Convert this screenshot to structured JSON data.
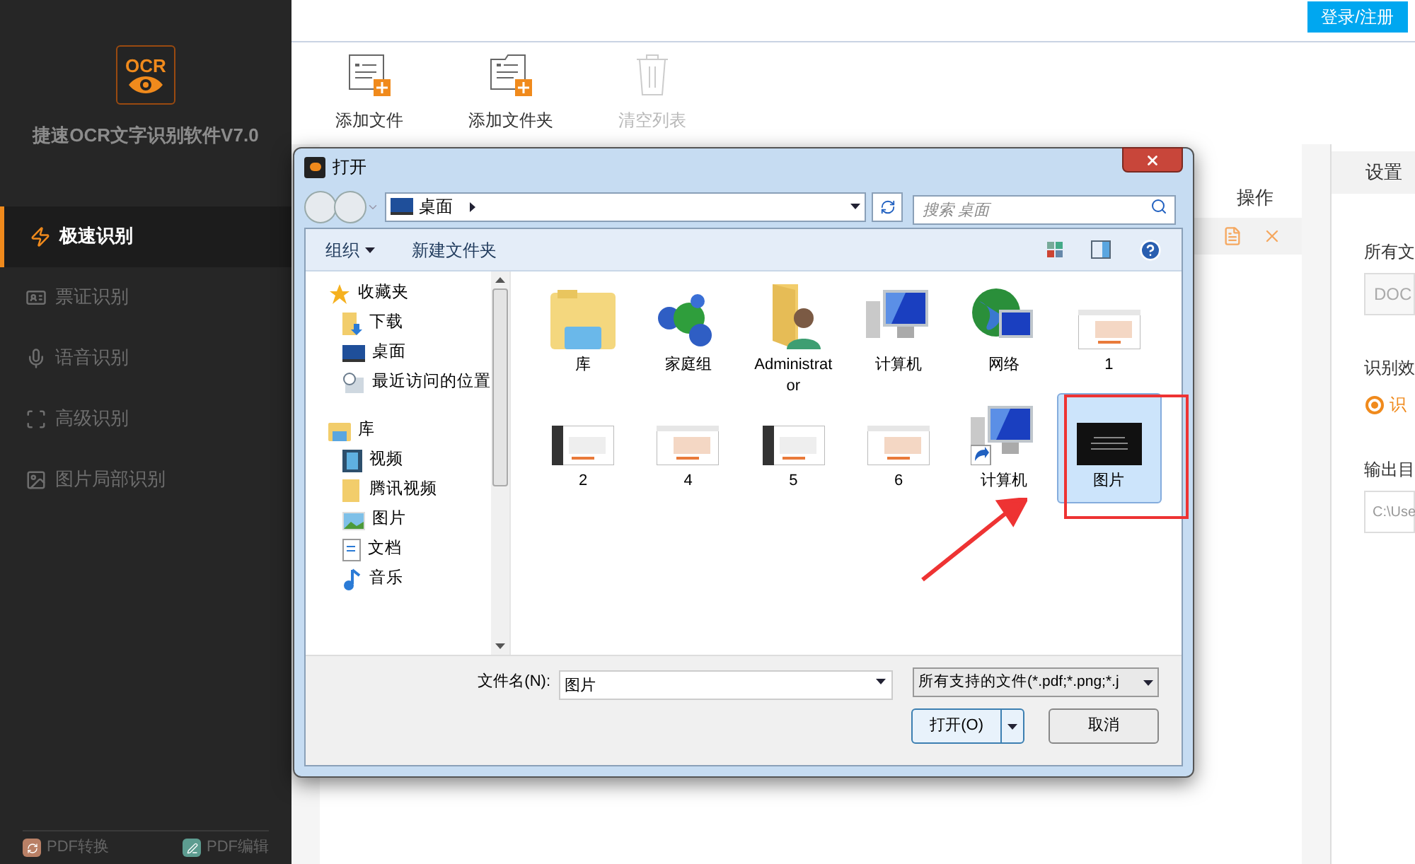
{
  "app": {
    "logo": "OCR",
    "title": "捷速OCR文字识别软件V7.0"
  },
  "sidebar": {
    "items": [
      {
        "label": "极速识别",
        "selected": true
      },
      {
        "label": "票证识别",
        "selected": false
      },
      {
        "label": "语音识别",
        "selected": false
      },
      {
        "label": "高级识别",
        "selected": false
      },
      {
        "label": "图片局部识别",
        "selected": false
      }
    ],
    "footer": [
      "PDF转换",
      "PDF编辑"
    ]
  },
  "header": {
    "login": "登录/注册"
  },
  "toolbar": [
    {
      "label": "添加文件",
      "disabled": false
    },
    {
      "label": "添加文件夹",
      "disabled": false
    },
    {
      "label": "清空列表",
      "disabled": true
    }
  ],
  "table": {
    "columns": [
      "操作"
    ]
  },
  "settings": {
    "title": "设置",
    "format_label": "所有文",
    "format_value": "DOC",
    "effect_label": "识别效",
    "effect_option": {
      "label": "识",
      "selected": true
    },
    "output_label": "输出目",
    "output_value": "C:\\Use"
  },
  "dialog": {
    "title": "打开",
    "location": "桌面",
    "search_placeholder": "搜索 桌面",
    "commands": [
      "组织",
      "新建文件夹"
    ],
    "nav": [
      {
        "label": "收藏夹",
        "kind": "star",
        "children": [
          {
            "label": "下载",
            "kind": "download"
          },
          {
            "label": "桌面",
            "kind": "desktop"
          },
          {
            "label": "最近访问的位置",
            "kind": "recent"
          }
        ]
      },
      {
        "label": "库",
        "kind": "library",
        "children": [
          {
            "label": "视频",
            "kind": "video"
          },
          {
            "label": "腾讯视频",
            "kind": "folder"
          },
          {
            "label": "图片",
            "kind": "image"
          },
          {
            "label": "文档",
            "kind": "document"
          },
          {
            "label": "音乐",
            "kind": "music"
          }
        ]
      }
    ],
    "files": [
      {
        "name": "库",
        "kind": "library",
        "selected": false
      },
      {
        "name": "家庭组",
        "kind": "homegroup",
        "selected": false
      },
      {
        "name": "Administrator",
        "kind": "user",
        "selected": false
      },
      {
        "name": "计算机",
        "kind": "computer",
        "selected": false
      },
      {
        "name": "网络",
        "kind": "network",
        "selected": false
      },
      {
        "name": "1",
        "kind": "thumbnail",
        "selected": false
      },
      {
        "name": "2",
        "kind": "thumbnail",
        "selected": false
      },
      {
        "name": "4",
        "kind": "thumbnail",
        "selected": false
      },
      {
        "name": "5",
        "kind": "thumbnail",
        "selected": false
      },
      {
        "name": "6",
        "kind": "thumbnail",
        "selected": false
      },
      {
        "name": "计算机",
        "kind": "shortcut",
        "selected": false
      },
      {
        "name": "图片",
        "kind": "dark-image",
        "selected": true
      }
    ],
    "filename_label": "文件名(N):",
    "filename": "图片",
    "filter": "所有支持的文件(*.pdf;*.png;*.j",
    "buttons": [
      "打开(O)",
      "取消"
    ]
  }
}
